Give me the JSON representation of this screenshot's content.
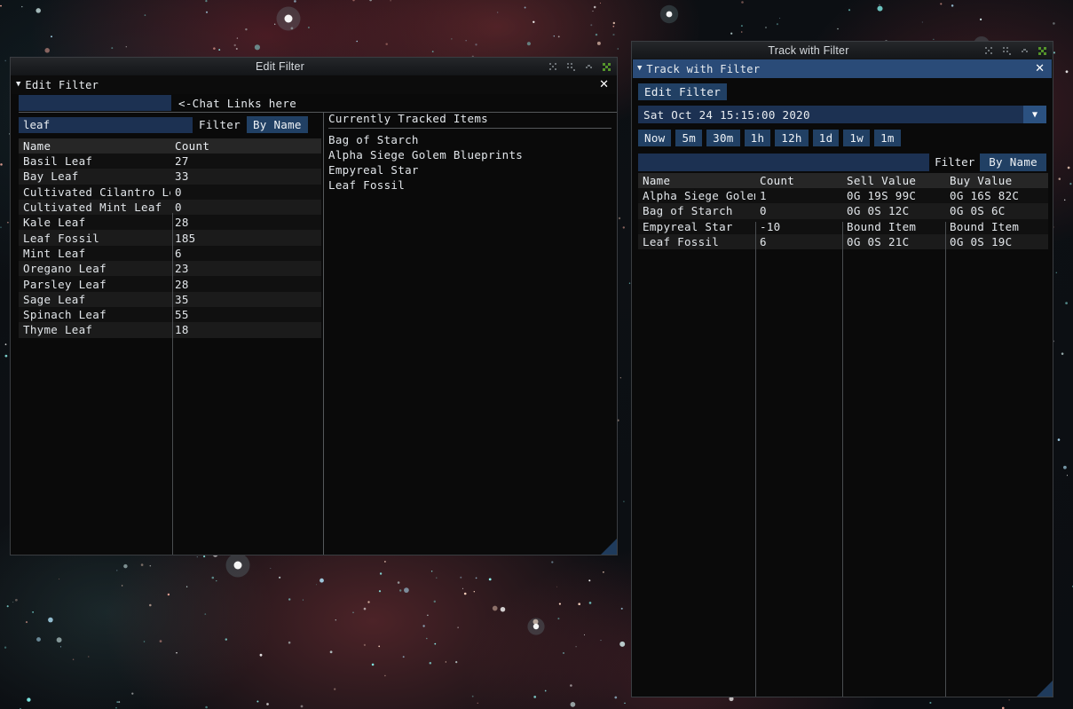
{
  "windows": {
    "edit_filter": {
      "wm_title": "Edit Filter",
      "panel_title": "Edit Filter",
      "chat_link_input_value": "",
      "chat_link_hint": "<-Chat Links here",
      "filter_input_value": "leaf",
      "filter_label": "Filter",
      "filter_mode_button": "By Name",
      "columns": [
        "Name",
        "Count"
      ],
      "rows": [
        {
          "name": "Basil Leaf",
          "count": "27"
        },
        {
          "name": "Bay Leaf",
          "count": "33"
        },
        {
          "name": "Cultivated Cilantro Lea",
          "count": "0"
        },
        {
          "name": "Cultivated Mint Leaf",
          "count": "0"
        },
        {
          "name": "Kale Leaf",
          "count": "28"
        },
        {
          "name": "Leaf Fossil",
          "count": "185"
        },
        {
          "name": "Mint Leaf",
          "count": "6"
        },
        {
          "name": "Oregano Leaf",
          "count": "23"
        },
        {
          "name": "Parsley Leaf",
          "count": "28"
        },
        {
          "name": "Sage Leaf",
          "count": "35"
        },
        {
          "name": "Spinach Leaf",
          "count": "55"
        },
        {
          "name": "Thyme Leaf",
          "count": "18"
        }
      ],
      "tracked_header": "Currently Tracked Items",
      "tracked_items": [
        "Bag of Starch",
        "Alpha Siege Golem Blueprints",
        "Empyreal Star",
        "Leaf Fossil"
      ]
    },
    "track_with_filter": {
      "wm_title": "Track with Filter",
      "panel_title": "Track with Filter",
      "edit_filter_button": "Edit Filter",
      "datetime_value": "Sat Oct 24 15:15:00 2020",
      "time_buttons": [
        "Now",
        "5m",
        "30m",
        "1h",
        "12h",
        "1d",
        "1w",
        "1m"
      ],
      "filter_input_value": "",
      "filter_label": "Filter",
      "filter_mode_button": "By Name",
      "columns": [
        "Name",
        "Count",
        "Sell Value",
        "Buy Value"
      ],
      "rows": [
        {
          "name": "Alpha Siege Golem",
          "count": "1",
          "sell": "0G 19S 99C",
          "buy": "0G 16S 82C"
        },
        {
          "name": "Bag of Starch",
          "count": "0",
          "sell": "0G 0S 12C",
          "buy": "0G 0S 6C"
        },
        {
          "name": "Empyreal Star",
          "count": "-10",
          "sell": "Bound Item",
          "buy": "Bound Item"
        },
        {
          "name": "Leaf Fossil",
          "count": "6",
          "sell": "0G 0S 21C",
          "buy": "0G 0S 19C"
        }
      ]
    }
  },
  "icons": {
    "collapse_triangle": "▼",
    "dropdown_caret": "▼",
    "close_x": "✕"
  },
  "colors": {
    "titlebar_active": "#2a4b78",
    "button_blue": "#214064",
    "input_blue": "#1c3152",
    "panel_bg": "#0a0a0a",
    "close_green": "#5faa2d"
  }
}
